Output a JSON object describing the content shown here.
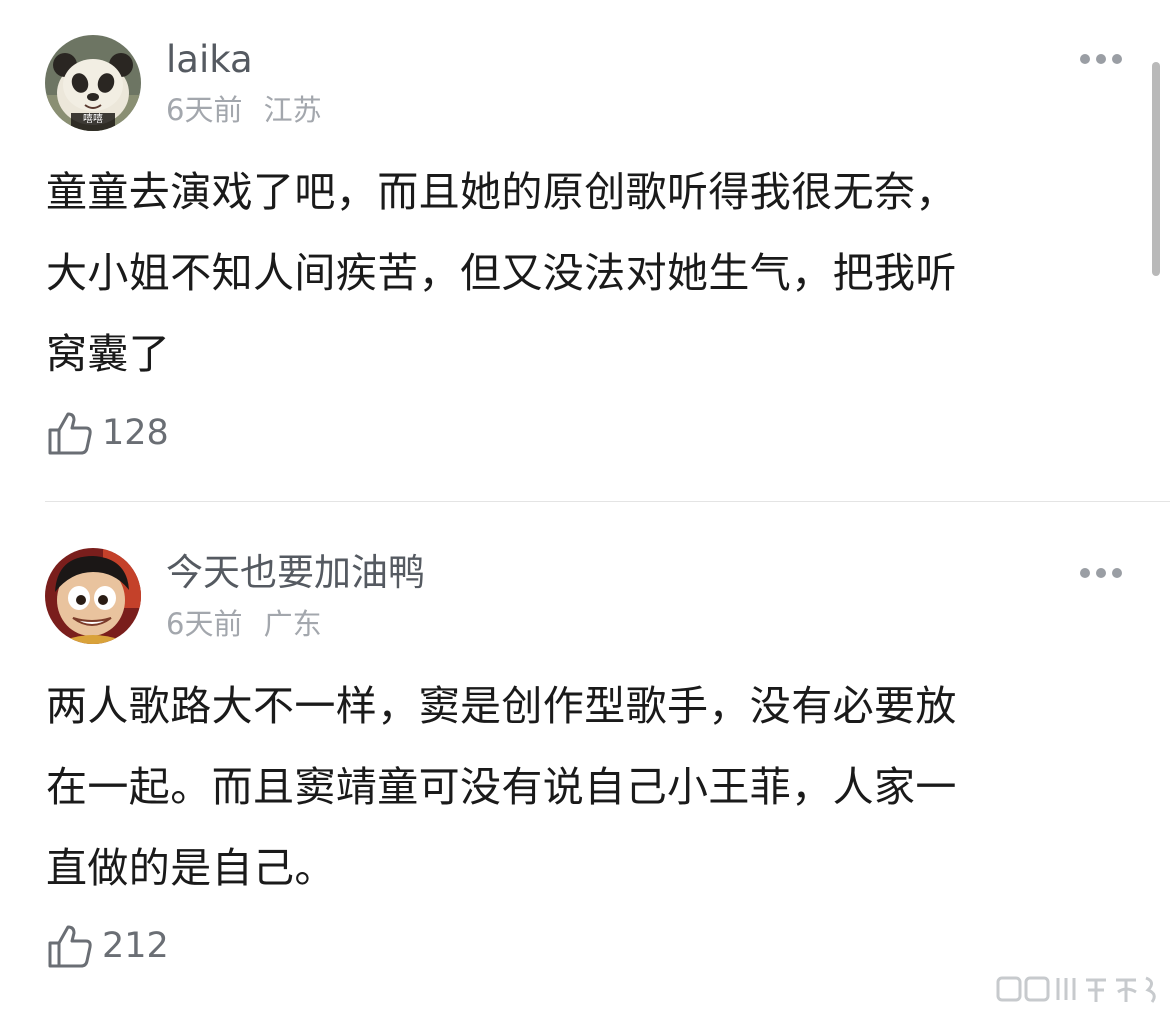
{
  "comments": [
    {
      "username": "laika",
      "time": "6天前",
      "location": "江苏",
      "avatar_label": "嘻嘻",
      "lines": [
        "童童去演戏了吧，而且她的原创歌听得我很无奈，",
        "大小姐不知人间疾苦，但又没法对她生气，把我听",
        "窝囊了"
      ],
      "likes": "128"
    },
    {
      "username": "今天也要加油鸭",
      "time": "6天前",
      "location": "广东",
      "lines": [
        "两人歌路大不一样，窦是创作型歌手，没有必要放",
        "在一起。而且窦靖童可没有说自己小王菲，人家一",
        "直做的是自己。"
      ],
      "likes": "212"
    }
  ],
  "icons": {
    "more": "more-dots-icon",
    "like": "thumbs-up-icon"
  },
  "colors": {
    "username": "#555a61",
    "meta": "#a3a7ad",
    "text": "#1a1a1a",
    "divider": "#e4e4e4"
  }
}
